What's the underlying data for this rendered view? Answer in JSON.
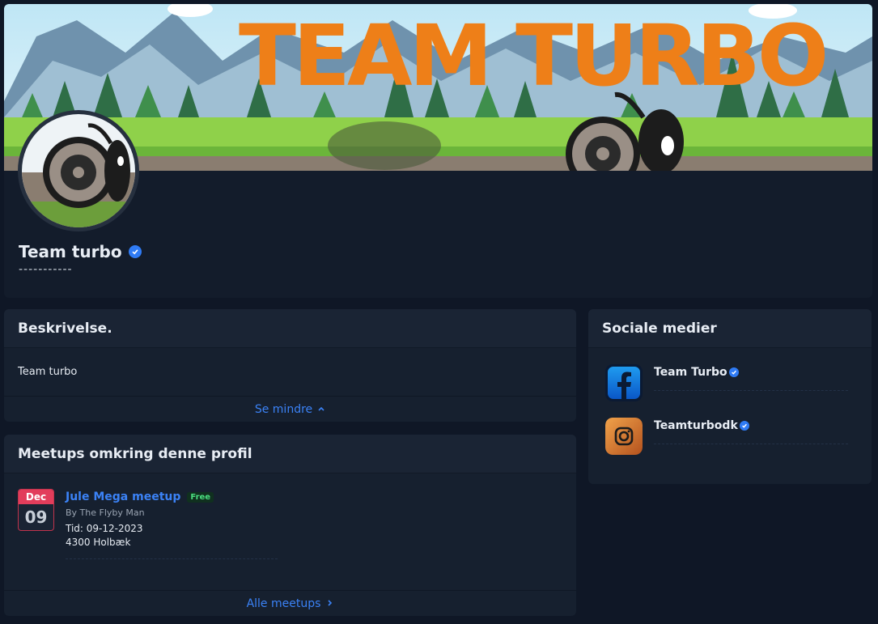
{
  "profile": {
    "banner_title": "TEAM TURBO",
    "name": "Team turbo",
    "dashes": "-----------",
    "verified_icon": "verified-check-icon"
  },
  "description": {
    "title": "Beskrivelse.",
    "text": "Team turbo",
    "toggle_label": "Se mindre",
    "toggle_icon": "chevron-up-icon"
  },
  "meetups": {
    "title": "Meetups omkring denne profil",
    "items": [
      {
        "month": "Dec",
        "day": "09",
        "title": "Jule Mega meetup",
        "badge": "Free",
        "by": "By The Flyby Man",
        "time": "Tid: 09-12-2023",
        "location": "4300 Holbæk"
      }
    ],
    "all_label": "Alle meetups",
    "all_icon": "chevron-right-icon"
  },
  "social": {
    "title": "Sociale medier",
    "items": [
      {
        "name": "Team Turbo",
        "icon": "facebook-icon"
      },
      {
        "name": "Teamturbodk",
        "icon": "instagram-icon"
      }
    ]
  },
  "colors": {
    "background": "#0f1726",
    "card": "#16202f",
    "accent": "#3b82f6",
    "date_badge": "#e23d5b",
    "free_badge": "#4ade80"
  }
}
